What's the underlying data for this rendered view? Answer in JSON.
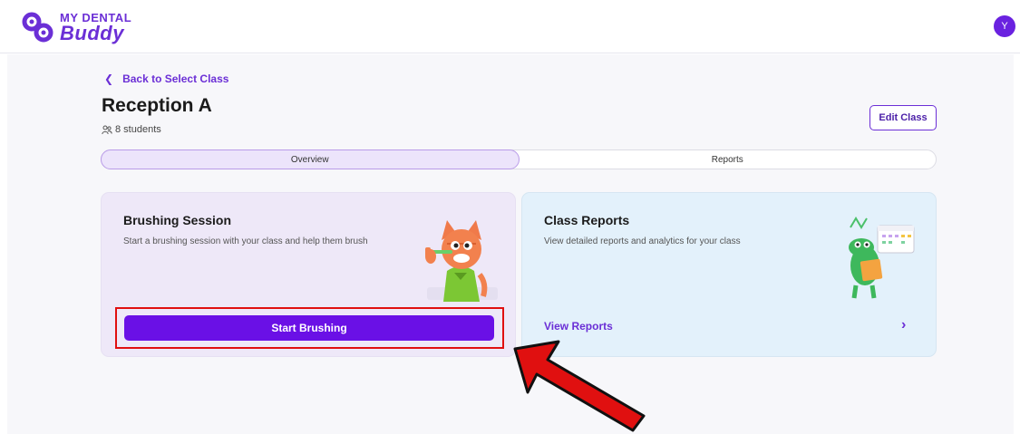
{
  "app": {
    "logo_line1": "MY DENTAL",
    "logo_line2": "Buddy",
    "avatar_initial": "Y",
    "brand_color": "#6a10e6"
  },
  "nav": {
    "back_label": "Back to Select Class"
  },
  "class_info": {
    "title": "Reception A",
    "students": "8 students",
    "edit_label": "Edit Class"
  },
  "tabs": [
    {
      "label": "Overview",
      "active": true
    },
    {
      "label": "Reports",
      "active": false
    }
  ],
  "cards": {
    "brushing": {
      "title": "Brushing Session",
      "description": "Start a brushing session with your class and help them brush",
      "button_label": "Start Brushing",
      "illustration": "cat-brushing-teeth"
    },
    "reports": {
      "title": "Class Reports",
      "description": "View detailed reports and analytics for your class",
      "link_label": "View Reports",
      "illustration": "dinosaur-with-calendar"
    }
  },
  "annotation": {
    "highlight_color": "#e01010",
    "arrow_color": "#e01010"
  }
}
